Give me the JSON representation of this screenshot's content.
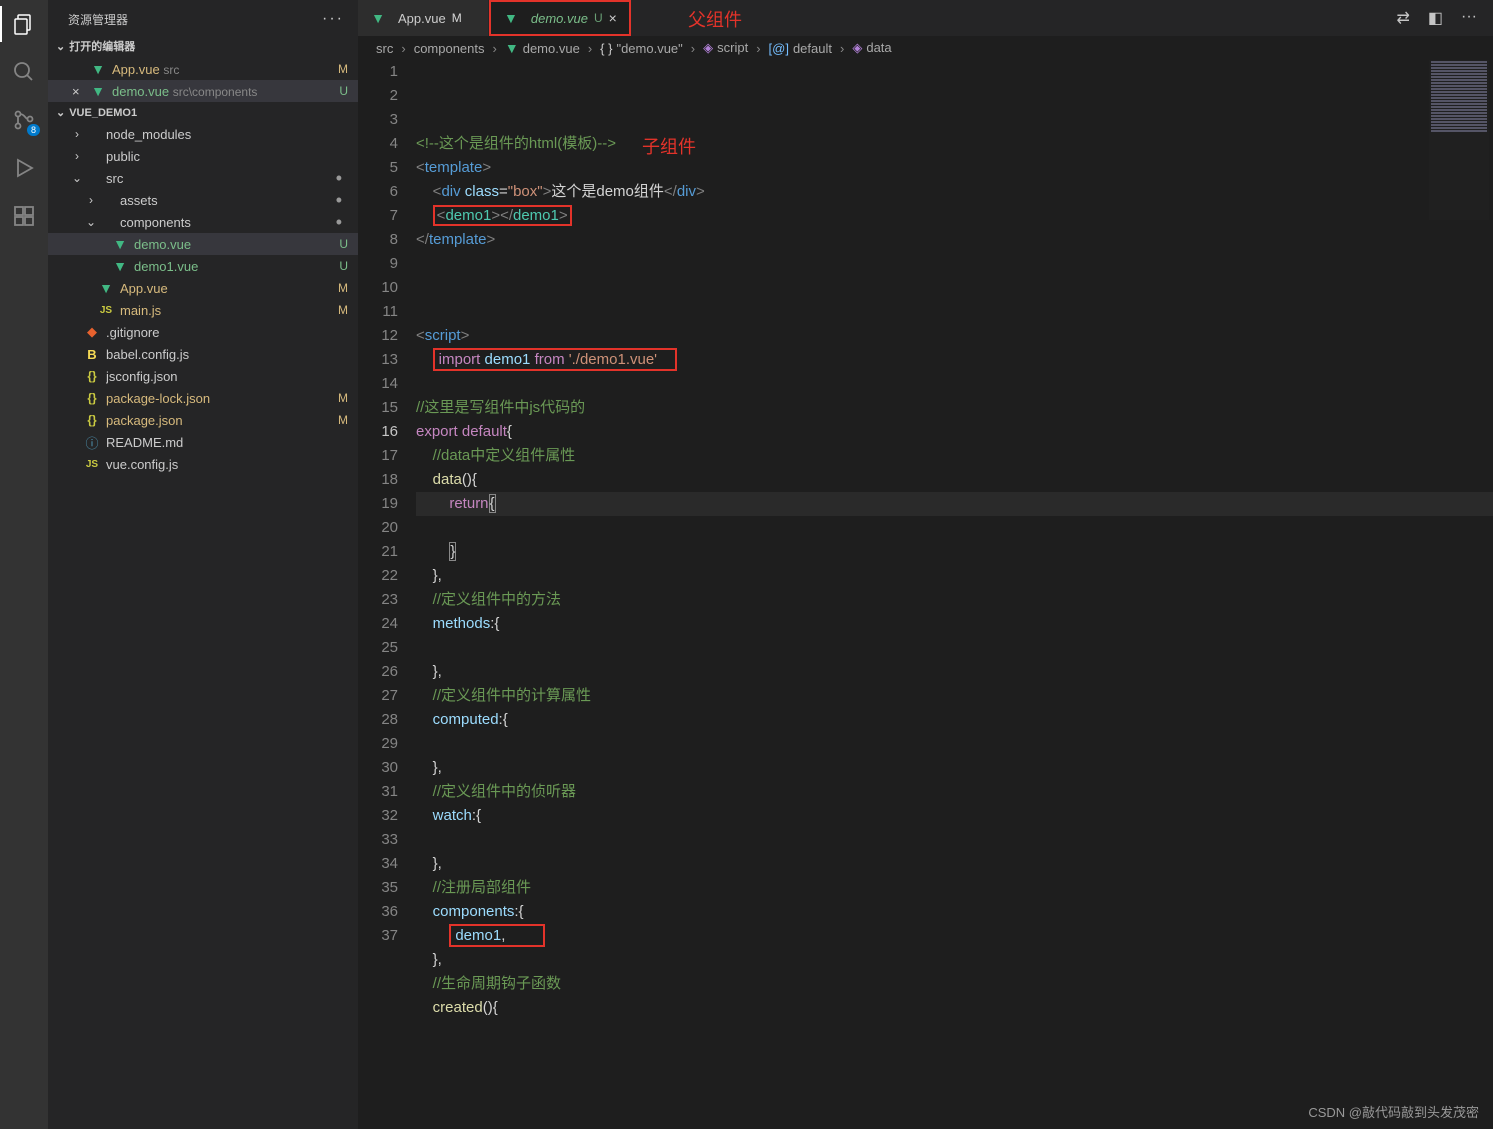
{
  "sidebarTitle": "资源管理器",
  "openEditorsLabel": "打开的编辑器",
  "activityBadge": "8",
  "openEditors": [
    {
      "icon": "vue",
      "name": "App.vue",
      "meta": "src",
      "status": "M"
    },
    {
      "icon": "vue",
      "name": "demo.vue",
      "meta": "src\\components",
      "status": "U",
      "active": true,
      "closeable": true
    }
  ],
  "projectName": "VUE_DEMO1",
  "tree": [
    {
      "indent": 1,
      "chev": ">",
      "ico": "folder",
      "name": "node_modules"
    },
    {
      "indent": 1,
      "chev": ">",
      "ico": "folder",
      "name": "public"
    },
    {
      "indent": 1,
      "chev": "v",
      "ico": "folder",
      "name": "src",
      "dot": true
    },
    {
      "indent": 2,
      "chev": ">",
      "ico": "folder",
      "name": "assets",
      "dot": true
    },
    {
      "indent": 2,
      "chev": "v",
      "ico": "folder",
      "name": "components",
      "dot": true
    },
    {
      "indent": 3,
      "ico": "vue",
      "name": "demo.vue",
      "status": "U",
      "selected": true
    },
    {
      "indent": 3,
      "ico": "vue",
      "name": "demo1.vue",
      "status": "U"
    },
    {
      "indent": 2,
      "ico": "vue",
      "name": "App.vue",
      "status": "M"
    },
    {
      "indent": 2,
      "ico": "js",
      "name": "main.js",
      "status": "M"
    },
    {
      "indent": 1,
      "ico": "git",
      "name": ".gitignore"
    },
    {
      "indent": 1,
      "ico": "babel",
      "name": "babel.config.js"
    },
    {
      "indent": 1,
      "ico": "json",
      "name": "jsconfig.json"
    },
    {
      "indent": 1,
      "ico": "json",
      "name": "package-lock.json",
      "status": "M"
    },
    {
      "indent": 1,
      "ico": "json",
      "name": "package.json",
      "status": "M"
    },
    {
      "indent": 1,
      "ico": "info",
      "name": "README.md"
    },
    {
      "indent": 1,
      "ico": "js",
      "name": "vue.config.js"
    }
  ],
  "tabs": [
    {
      "icon": "vue",
      "name": "App.vue",
      "suffix": "M",
      "active": false,
      "italic": false
    },
    {
      "icon": "vue",
      "name": "demo.vue",
      "suffix": "U",
      "active": true,
      "italic": true,
      "nameColor": "#7bbe8a",
      "redbox": true
    }
  ],
  "annotations": {
    "parent": "父组件",
    "child": "子组件"
  },
  "breadcrumbs": [
    "src",
    "components",
    "demo.vue",
    "\"demo.vue\"",
    "script",
    "default",
    "data"
  ],
  "breadcrumbIcons": [
    "",
    "",
    "vue",
    "{}",
    "cube",
    "[@]",
    "cube"
  ],
  "code": [
    {
      "n": 1,
      "html": "<span class='c-comment'>&lt;!--这个是组件的html(模板)--&gt;</span>"
    },
    {
      "n": 2,
      "html": "<span class='c-brk'>&lt;</span><span class='c-tag'>template</span><span class='c-brk'>&gt;</span>"
    },
    {
      "n": 3,
      "html": "    <span class='c-brk'>&lt;</span><span class='c-tag'>div</span> <span class='c-attr'>class</span>=<span class='c-str'>\"box\"</span><span class='c-brk'>&gt;</span><span class='c-txt'>这个是demo组件</span><span class='c-brk'>&lt;/</span><span class='c-tag'>div</span><span class='c-brk'>&gt;</span>"
    },
    {
      "n": 4,
      "html": "    <span class='redbox-inline'><span class='c-brk'>&lt;</span><span class='c-tag' style='color:#4ec9b0'>demo1</span><span class='c-brk'>&gt;&lt;/</span><span class='c-tag' style='color:#4ec9b0'>demo1</span><span class='c-brk'>&gt;</span></span>"
    },
    {
      "n": 5,
      "html": "<span class='c-brk'>&lt;/</span><span class='c-tag'>template</span><span class='c-brk'>&gt;</span>"
    },
    {
      "n": 6,
      "html": ""
    },
    {
      "n": 7,
      "html": ""
    },
    {
      "n": 8,
      "html": ""
    },
    {
      "n": 9,
      "html": "<span class='c-brk'>&lt;</span><span class='c-tag'>script</span><span class='c-brk'>&gt;</span>"
    },
    {
      "n": 10,
      "html": "    <span class='redbox-inline' style='padding:1px 18px 1px 4px'><span class='c-kw'>import</span> <span class='c-var'>demo1</span> <span class='c-kw'>from</span> <span class='c-str'>'./demo1.vue'</span></span>"
    },
    {
      "n": 11,
      "html": ""
    },
    {
      "n": 12,
      "html": "<span class='c-comment'>//这里是写组件中js代码的</span>"
    },
    {
      "n": 13,
      "html": "<span class='c-kw'>export</span> <span class='c-kw'>default</span><span class='c-txt'>{</span>"
    },
    {
      "n": 14,
      "html": "    <span class='c-comment'>//data中定义组件属性</span>"
    },
    {
      "n": 15,
      "html": "    <span class='c-fn'>data</span>(){"
    },
    {
      "n": 16,
      "html": "        <span class='c-kw'>return</span><span style='border:1px solid #888'>{</span>",
      "active": true
    },
    {
      "n": 17,
      "html": ""
    },
    {
      "n": 18,
      "html": "        <span style='border:1px solid #888'>}</span>"
    },
    {
      "n": 19,
      "html": "    },"
    },
    {
      "n": 20,
      "html": "    <span class='c-comment'>//定义组件中的方法</span>"
    },
    {
      "n": 21,
      "html": "    <span class='c-var'>methods</span>:{"
    },
    {
      "n": 22,
      "html": ""
    },
    {
      "n": 23,
      "html": "    },"
    },
    {
      "n": 24,
      "html": "    <span class='c-comment'>//定义组件中的计算属性</span>"
    },
    {
      "n": 25,
      "html": "    <span class='c-var'>computed</span>:{"
    },
    {
      "n": 26,
      "html": ""
    },
    {
      "n": 27,
      "html": "    },"
    },
    {
      "n": 28,
      "html": "    <span class='c-comment'>//定义组件中的侦听器</span>"
    },
    {
      "n": 29,
      "html": "    <span class='c-var'>watch</span>:{"
    },
    {
      "n": 30,
      "html": ""
    },
    {
      "n": 31,
      "html": "    },"
    },
    {
      "n": 32,
      "html": "    <span class='c-comment'>//注册局部组件</span>"
    },
    {
      "n": 33,
      "html": "    <span class='c-var'>components</span>:{"
    },
    {
      "n": 34,
      "html": "        <span class='redbox-inline' style='padding:1px 38px 1px 4px'><span class='c-var'>demo1</span>,</span>"
    },
    {
      "n": 35,
      "html": "    },"
    },
    {
      "n": 36,
      "html": "    <span class='c-comment'>//生命周期钩子函数</span>"
    },
    {
      "n": 37,
      "html": "    <span class='c-fn'>created</span>(){"
    }
  ],
  "watermark": "CSDN @敲代码敲到头发茂密"
}
